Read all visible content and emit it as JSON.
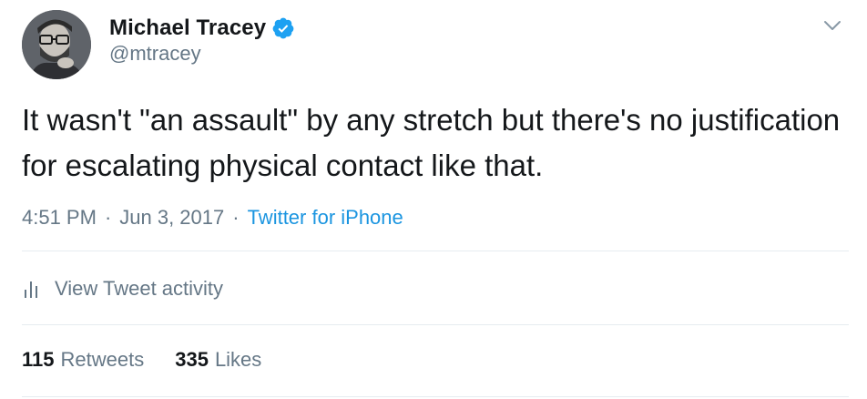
{
  "user": {
    "display_name": "Michael Tracey",
    "handle": "@mtracey",
    "avatar_icon": "avatar-photo",
    "verified_icon": "verified-badge-icon"
  },
  "tweet": {
    "text": "It wasn't \"an assault\" by any stretch but there's no justification for escalating physical contact like that."
  },
  "meta": {
    "time": "4:51 PM",
    "separator": "·",
    "date": "Jun 3, 2017",
    "source": "Twitter for iPhone"
  },
  "activity": {
    "label": "View Tweet activity",
    "icon": "bar-chart-icon"
  },
  "stats": {
    "retweets_count": "115",
    "retweets_label": "Retweets",
    "likes_count": "335",
    "likes_label": "Likes"
  },
  "menu": {
    "icon": "chevron-down-icon"
  },
  "colors": {
    "text_primary": "#14171a",
    "text_secondary": "#657786",
    "link": "#1b95e0",
    "verified": "#1da1f2",
    "divider": "#e6ecf0"
  }
}
